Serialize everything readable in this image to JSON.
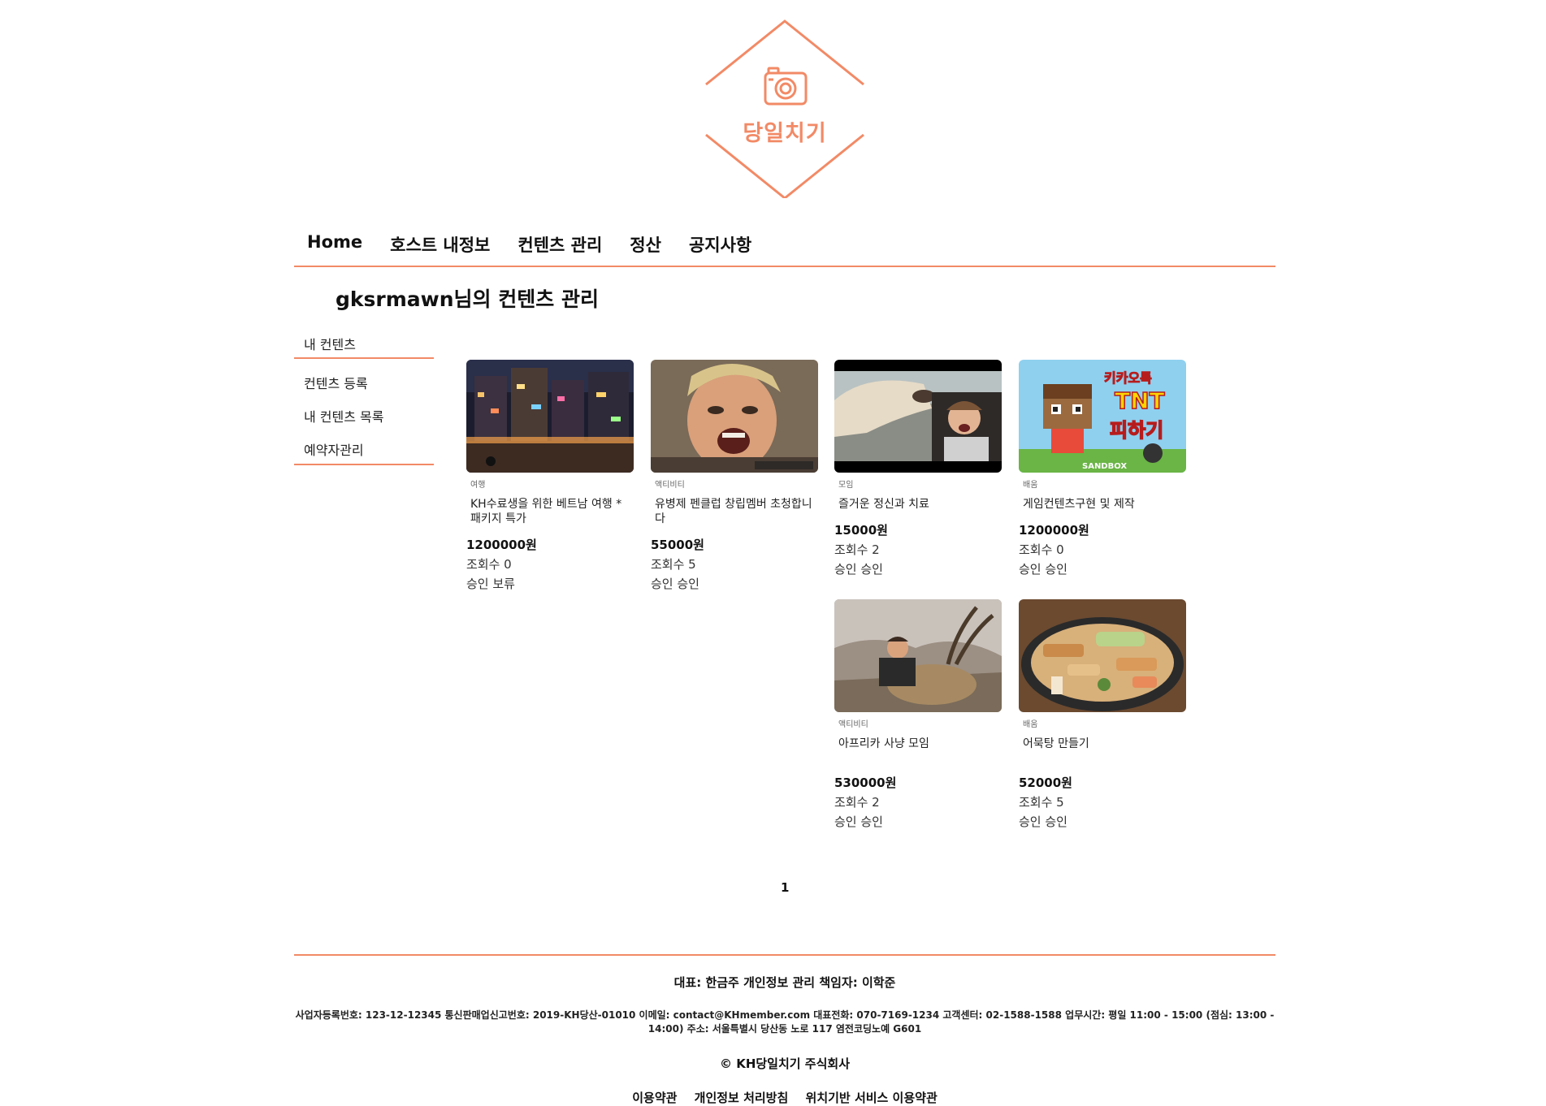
{
  "brand": {
    "logo_text": "당일치기",
    "accent_color": "#f28a66",
    "logo_icon": "camera-icon"
  },
  "nav": {
    "items": [
      "Home",
      "호스트 내정보",
      "컨텐츠 관리",
      "정산",
      "공지사항"
    ]
  },
  "page": {
    "title": "gksrmawn님의 컨텐츠 관리"
  },
  "sidebar": {
    "header": "내 컨텐츠",
    "items": [
      "컨텐츠 등록",
      "내 컨텐츠 목록",
      "예약자관리"
    ]
  },
  "contents": [
    {
      "category": "여행",
      "title": "KH수료생을 위한 베트남 여행 * 패키지 특가",
      "price": "1200000원",
      "views": "조회수 0",
      "status": "승인 보류",
      "image": "night-street-photo"
    },
    {
      "category": "액티비티",
      "title": "유병제 펜클럽 창립멤버 초청합니다",
      "price": "55000원",
      "views": "조회수 5",
      "status": "승인 승인",
      "image": "shouting-man-photo"
    },
    {
      "category": "모임",
      "title": "즐거운 정신과 치료",
      "price": "15000원",
      "views": "조회수 2",
      "status": "승인 승인",
      "image": "horse-car-photo"
    },
    {
      "category": "배움",
      "title": "게임컨텐츠구현 및 제작",
      "price": "1200000원",
      "views": "조회수 0",
      "status": "승인 승인",
      "image": "tnt-game-banner",
      "image_text": [
        "키카오톡",
        "TNT",
        "피하기",
        "SANDBOX"
      ]
    },
    {
      "category": "액티비티",
      "title": "아프리카 사냥 모임",
      "price": "530000원",
      "views": "조회수 2",
      "status": "승인 승인",
      "image": "hunter-goat-photo"
    },
    {
      "category": "배움",
      "title": "어묵탕 만들기",
      "price": "52000원",
      "views": "조회수 5",
      "status": "승인 승인",
      "image": "fishcake-soup-photo"
    }
  ],
  "pagination": {
    "current": "1"
  },
  "footer": {
    "representative": "대표: 한금주 개인정보 관리 책임자: 이학준",
    "info": "사업자등록번호: 123-12-12345 통신판매업신고번호: 2019-KH당산-01010 이메일: contact@KHmember.com 대표전화: 070-7169-1234 고객센터: 02-1588-1588 업무시간: 평일 11:00 - 15:00 (점심: 13:00 - 14:00) 주소: 서울특별시 당산동 노로 117 염전코딩노예 G601",
    "copyright": "© KH당일치기 주식회사",
    "links": [
      "이용약관",
      "개인정보 처리방침",
      "위치기반 서비스 이용약관"
    ]
  }
}
